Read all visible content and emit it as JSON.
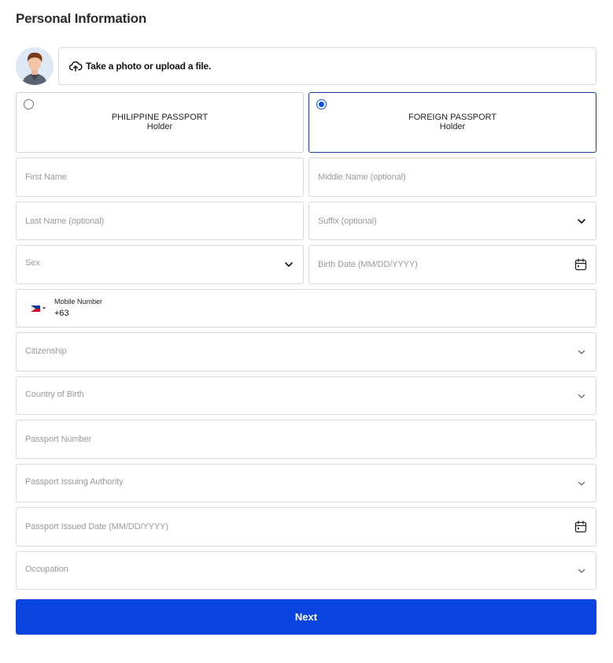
{
  "page": {
    "title": "Personal Information"
  },
  "photo": {
    "upload_label": "Take a photo or upload a file."
  },
  "passport_types": [
    {
      "line1": "PHILIPPINE PASSPORT",
      "line2": "Holder",
      "selected": false
    },
    {
      "line1": "FOREIGN PASSPORT",
      "line2": "Holder",
      "selected": true
    }
  ],
  "fields": {
    "first_name": "First Name",
    "middle_name": "Middle Name (optional)",
    "last_name": "Last Name (optional)",
    "suffix": "Suffix (optional)",
    "sex": "Sex",
    "birth_date": "Birth Date (MM/DD/YYYY)",
    "citizenship": "Citizenship",
    "country_of_birth": "Country of Birth",
    "passport_number": "Passport Number",
    "passport_issuing_authority": "Passport Issuing Authority",
    "passport_issued_date": "Passport Issued Date (MM/DD/YYYY)",
    "occupation": "Occupation"
  },
  "mobile": {
    "label": "Mobile Number",
    "value": "+63",
    "country_flag": "philippines-flag"
  },
  "actions": {
    "next_label": "Next"
  },
  "colors": {
    "primary": "#0a44e0",
    "radio_selected": "#0a55e6",
    "selected_border": "#1d3f9a",
    "field_border": "#d9d9d9",
    "placeholder": "#9a9a9a"
  }
}
